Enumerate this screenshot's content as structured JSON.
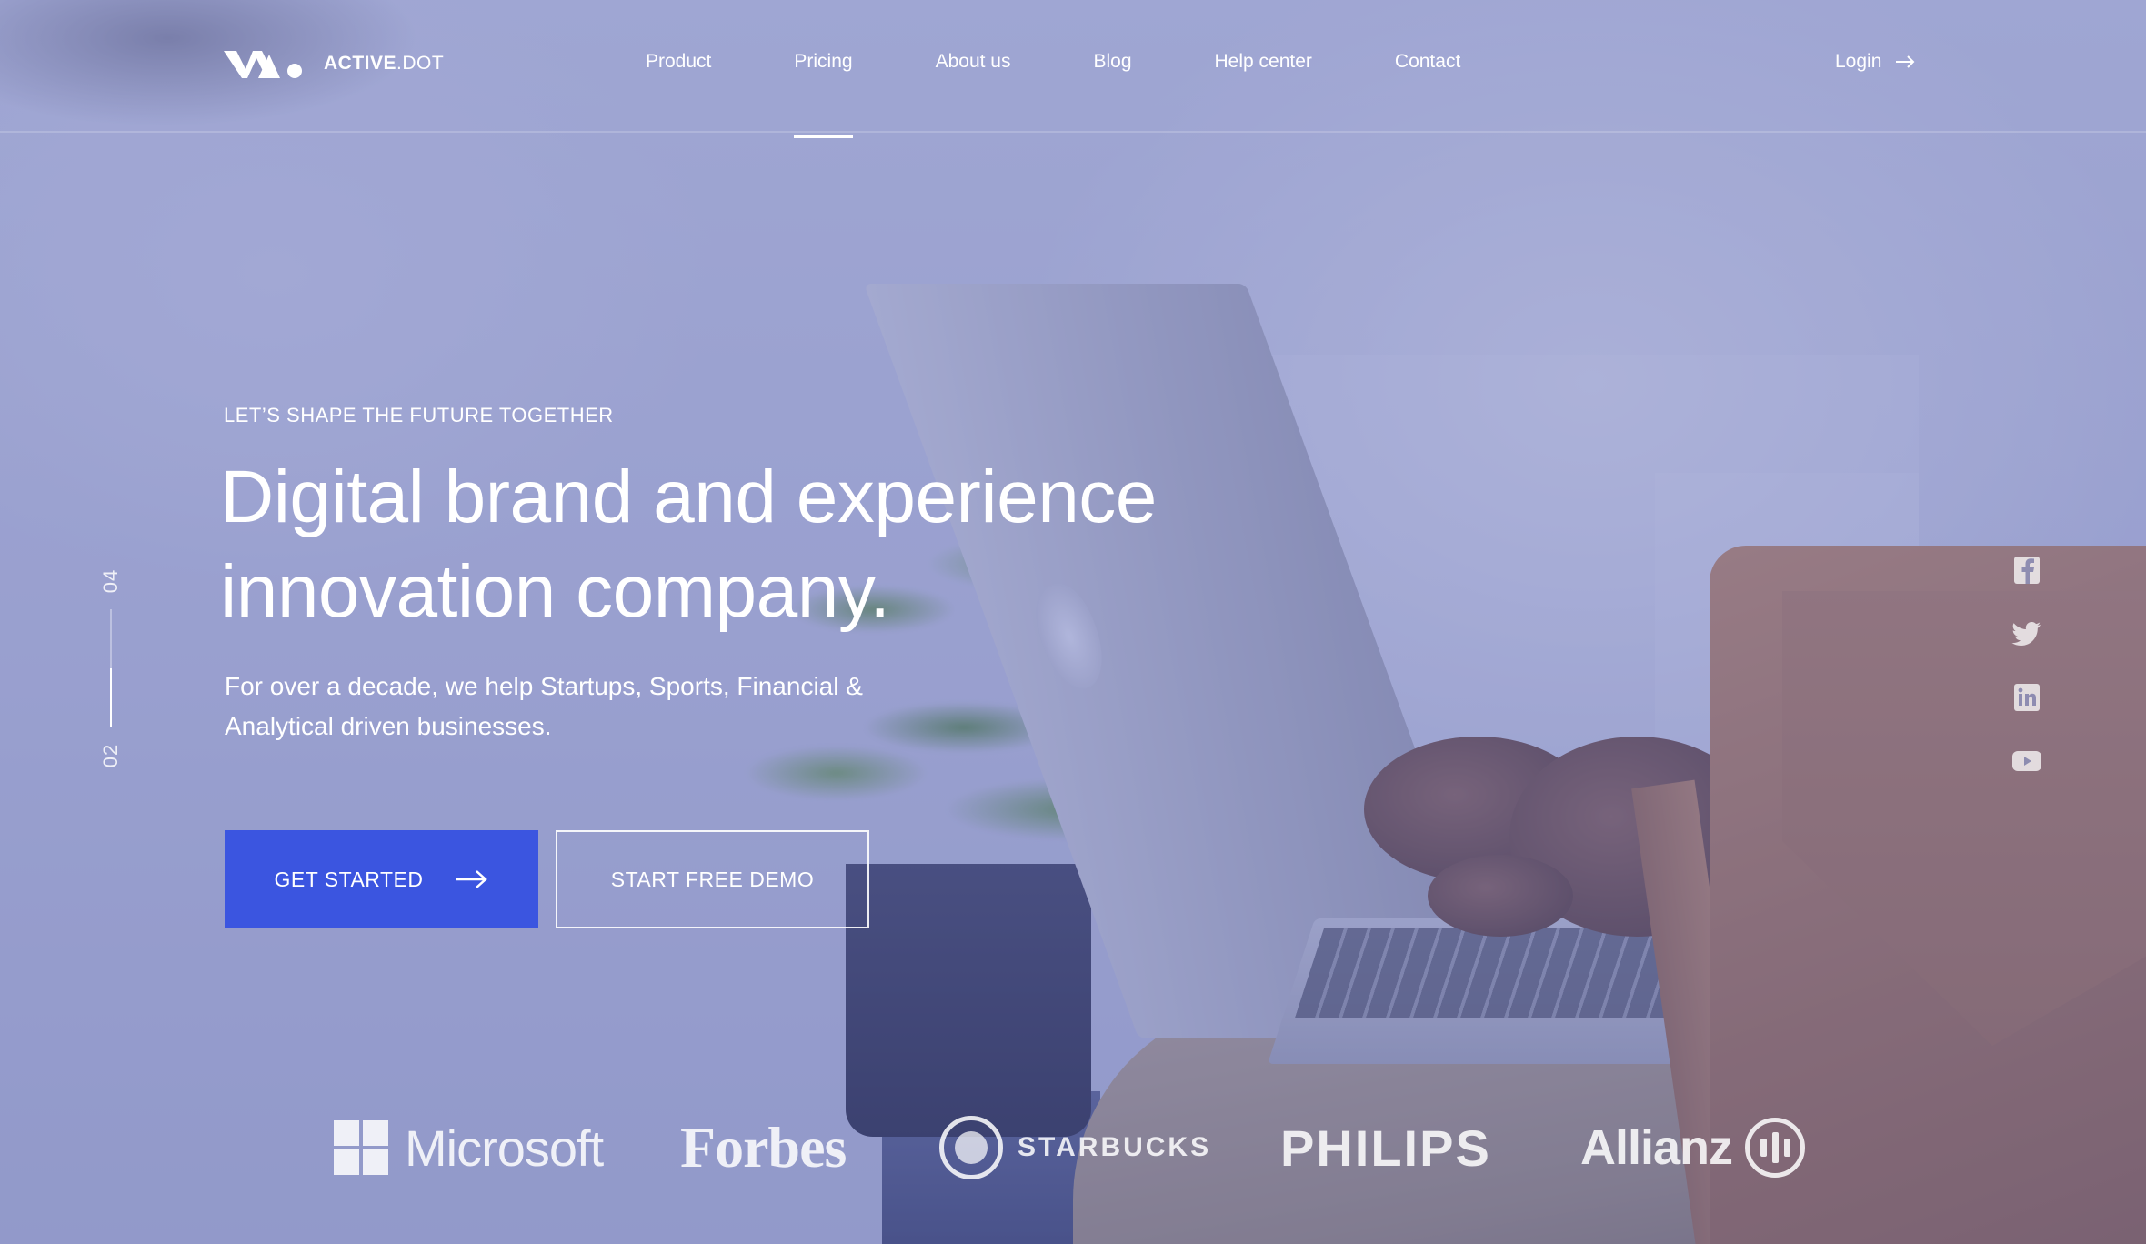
{
  "brand": {
    "logo_bold": "ACTIVE",
    "logo_light": ".DOT"
  },
  "nav": {
    "items": [
      {
        "label": "Product"
      },
      {
        "label": "Pricing",
        "active": true
      },
      {
        "label": "About us"
      },
      {
        "label": "Blog"
      },
      {
        "label": "Help center"
      },
      {
        "label": "Contact"
      }
    ],
    "login_label": "Login",
    "login_icon": "arrow-right-icon"
  },
  "hero": {
    "eyebrow": "LET’S SHAPE THE FUTURE TOGETHER",
    "headline_line1": "Digital brand and experience",
    "headline_line2": "innovation company.",
    "subtext_line1": "For over a decade, we help Startups, Sports, Financial &",
    "subtext_line2": "Analytical driven businesses.",
    "primary_button": "GET STARTED",
    "secondary_button": "START FREE DEMO",
    "slide_total": "04",
    "slide_current": "02",
    "slide_progress": 0.5
  },
  "social": {
    "icons": [
      "facebook-icon",
      "twitter-icon",
      "linkedin-icon",
      "youtube-icon"
    ]
  },
  "partners": {
    "microsoft": "Microsoft",
    "forbes": "Forbes",
    "starbucks": "STARBUCKS",
    "philips": "PHILIPS",
    "allianz": "Allianz"
  },
  "colors": {
    "accent": "#3b55e0",
    "overlay": "#5c68bc",
    "text": "#ffffff"
  }
}
